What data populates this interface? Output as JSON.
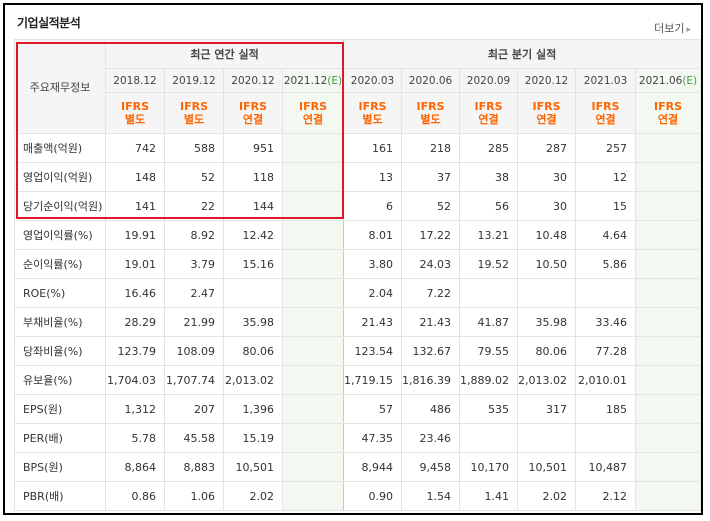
{
  "header": {
    "title": "기업실적분석",
    "more_label": "더보기",
    "more_arrow": "▸"
  },
  "table": {
    "row_header_label": "주요재무정보",
    "annual_group_label": "최근 연간 실적",
    "quarter_group_label": "최근 분기 실적",
    "estimate_mark": "(E)",
    "periods": [
      {
        "label": "2018.12",
        "ifrs": "IFRS",
        "basis": "별도",
        "estimate": false
      },
      {
        "label": "2019.12",
        "ifrs": "IFRS",
        "basis": "별도",
        "estimate": false
      },
      {
        "label": "2020.12",
        "ifrs": "IFRS",
        "basis": "연결",
        "estimate": false
      },
      {
        "label": "2021.12",
        "ifrs": "IFRS",
        "basis": "연결",
        "estimate": true
      },
      {
        "label": "2020.03",
        "ifrs": "IFRS",
        "basis": "별도",
        "estimate": false
      },
      {
        "label": "2020.06",
        "ifrs": "IFRS",
        "basis": "별도",
        "estimate": false
      },
      {
        "label": "2020.09",
        "ifrs": "IFRS",
        "basis": "연결",
        "estimate": false
      },
      {
        "label": "2020.12",
        "ifrs": "IFRS",
        "basis": "연결",
        "estimate": false
      },
      {
        "label": "2021.03",
        "ifrs": "IFRS",
        "basis": "연결",
        "estimate": false
      },
      {
        "label": "2021.06",
        "ifrs": "IFRS",
        "basis": "연결",
        "estimate": true
      }
    ],
    "rows": [
      {
        "label": "매출액(억원)",
        "values": [
          "742",
          "588",
          "951",
          "",
          "161",
          "218",
          "285",
          "287",
          "257",
          ""
        ]
      },
      {
        "label": "영업이익(억원)",
        "values": [
          "148",
          "52",
          "118",
          "",
          "13",
          "37",
          "38",
          "30",
          "12",
          ""
        ]
      },
      {
        "label": "당기순이익(억원)",
        "values": [
          "141",
          "22",
          "144",
          "",
          "6",
          "52",
          "56",
          "30",
          "15",
          ""
        ]
      },
      {
        "label": "영업이익률(%)",
        "values": [
          "19.91",
          "8.92",
          "12.42",
          "",
          "8.01",
          "17.22",
          "13.21",
          "10.48",
          "4.64",
          ""
        ]
      },
      {
        "label": "순이익률(%)",
        "values": [
          "19.01",
          "3.79",
          "15.16",
          "",
          "3.80",
          "24.03",
          "19.52",
          "10.50",
          "5.86",
          ""
        ]
      },
      {
        "label": "ROE(%)",
        "values": [
          "16.46",
          "2.47",
          "",
          "",
          "2.04",
          "7.22",
          "",
          "",
          "",
          ""
        ]
      },
      {
        "label": "부채비율(%)",
        "values": [
          "28.29",
          "21.99",
          "35.98",
          "",
          "21.43",
          "21.43",
          "41.87",
          "35.98",
          "33.46",
          ""
        ]
      },
      {
        "label": "당좌비율(%)",
        "values": [
          "123.79",
          "108.09",
          "80.06",
          "",
          "123.54",
          "132.67",
          "79.55",
          "80.06",
          "77.28",
          ""
        ]
      },
      {
        "label": "유보율(%)",
        "values": [
          "1,704.03",
          "1,707.74",
          "2,013.02",
          "",
          "1,719.15",
          "1,816.39",
          "1,889.02",
          "2,013.02",
          "2,010.01",
          ""
        ]
      },
      {
        "label": "EPS(원)",
        "values": [
          "1,312",
          "207",
          "1,396",
          "",
          "57",
          "486",
          "535",
          "317",
          "185",
          ""
        ]
      },
      {
        "label": "PER(배)",
        "values": [
          "5.78",
          "45.58",
          "15.19",
          "",
          "47.35",
          "23.46",
          "",
          "",
          "",
          ""
        ]
      },
      {
        "label": "BPS(원)",
        "values": [
          "8,864",
          "8,883",
          "10,501",
          "",
          "8,944",
          "9,458",
          "10,170",
          "10,501",
          "10,487",
          ""
        ]
      },
      {
        "label": "PBR(배)",
        "values": [
          "0.86",
          "1.06",
          "2.02",
          "",
          "0.90",
          "1.54",
          "1.41",
          "2.02",
          "2.12",
          ""
        ]
      }
    ],
    "group_breaks_before_rows": [
      3,
      6,
      9
    ],
    "highlight_color": "#e0162b",
    "ifrs_color": "#ff6400",
    "estimate_bg_color": "#f3f8f1"
  }
}
